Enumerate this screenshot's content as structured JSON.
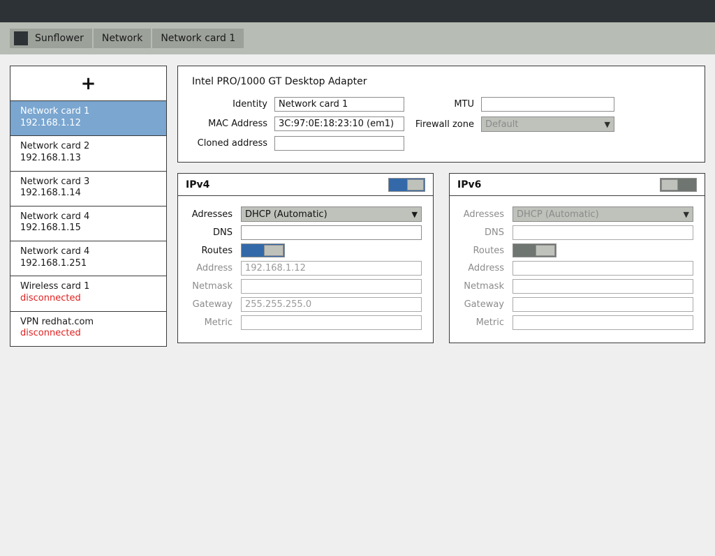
{
  "titlebar": {
    "name": "window-titlebar"
  },
  "breadcrumb": {
    "home_label": "Sunflower",
    "items": [
      {
        "label": "Network"
      },
      {
        "label": "Network card 1"
      }
    ]
  },
  "sidebar": {
    "add_label": "+",
    "items": [
      {
        "name": "Network card 1",
        "detail": "192.168.1.12",
        "selected": true,
        "disconnected": false
      },
      {
        "name": "Network card 2",
        "detail": "192.168.1.13",
        "selected": false,
        "disconnected": false
      },
      {
        "name": "Network card 3",
        "detail": "192.168.1.14",
        "selected": false,
        "disconnected": false
      },
      {
        "name": "Network card 4",
        "detail": "192.168.1.15",
        "selected": false,
        "disconnected": false
      },
      {
        "name": "Network card 4",
        "detail": "192.168.1.251",
        "selected": false,
        "disconnected": false
      },
      {
        "name": "Wireless card 1",
        "detail": "disconnected",
        "selected": false,
        "disconnected": true
      },
      {
        "name": "VPN redhat.com",
        "detail": "disconnected",
        "selected": false,
        "disconnected": true
      }
    ]
  },
  "identity": {
    "adapter_title": "Intel PRO/1000 GT Desktop Adapter",
    "identity_label": "Identity",
    "identity_value": "Network card 1",
    "mac_label": "MAC Address",
    "mac_value": "3C:97:0E:18:23:10 (em1)",
    "cloned_label": "Cloned address",
    "cloned_value": "",
    "mtu_label": "MTU",
    "mtu_value": "",
    "firewall_label": "Firewall zone",
    "firewall_value": "Default",
    "caret": "▼"
  },
  "ipv4": {
    "title": "IPv4",
    "enabled": true,
    "addresses_label": "Adresses",
    "addresses_value": "DHCP (Automatic)",
    "dns_label": "DNS",
    "dns_value": "",
    "routes_label": "Routes",
    "routes_enabled": true,
    "address_label": "Address",
    "address_value": "192.168.1.12",
    "netmask_label": "Netmask",
    "netmask_value": "",
    "gateway_label": "Gateway",
    "gateway_value": "255.255.255.0",
    "metric_label": "Metric",
    "metric_value": "",
    "caret": "▼"
  },
  "ipv6": {
    "title": "IPv6",
    "enabled": false,
    "addresses_label": "Adresses",
    "addresses_value": "DHCP (Automatic)",
    "dns_label": "DNS",
    "dns_value": "",
    "routes_label": "Routes",
    "routes_enabled": false,
    "address_label": "Address",
    "address_value": "",
    "netmask_label": "Netmask",
    "netmask_value": "",
    "gateway_label": "Gateway",
    "gateway_value": "",
    "metric_label": "Metric",
    "metric_value": "",
    "caret": "▼"
  },
  "colors": {
    "titlebar": "#2c3236",
    "crumbbar": "#b7bcb4",
    "crumb": "#9ca19a",
    "accent_blue": "#3369a9",
    "selected_row": "#7aa6d0",
    "disconnected_red": "#e02020",
    "page_bg": "#efefef"
  }
}
